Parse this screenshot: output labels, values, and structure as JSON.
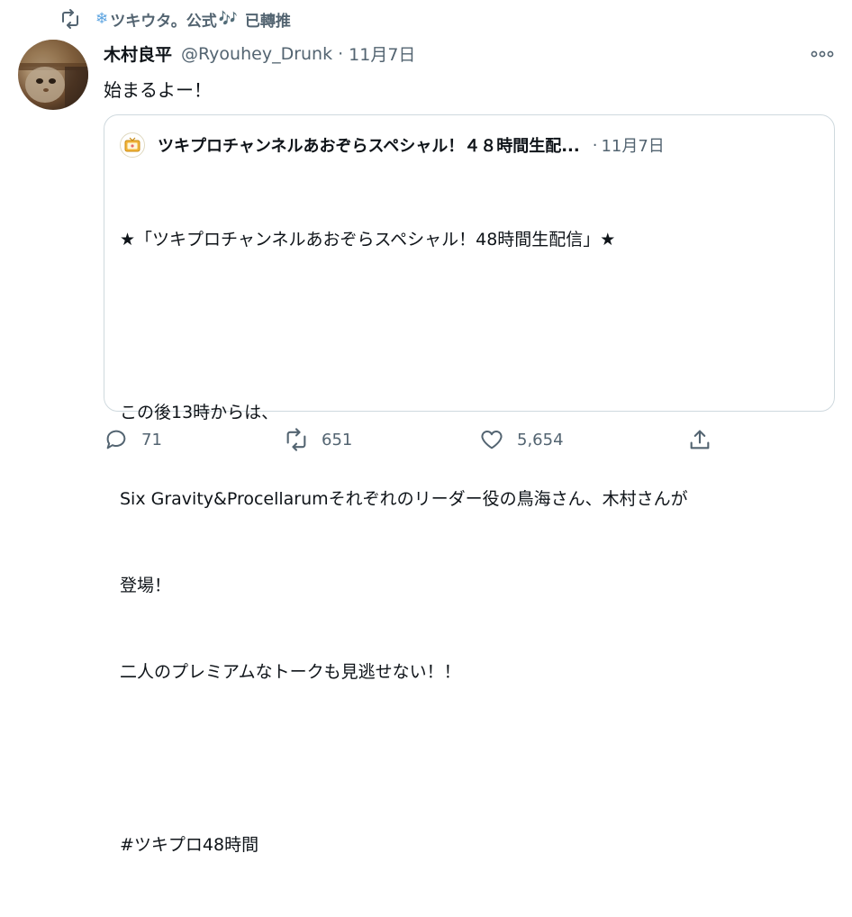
{
  "retweet_bar": {
    "user": "ツキウタ。公式",
    "label": "已轉推",
    "emoji_snow": "❄",
    "emoji_note": "🎶"
  },
  "tweet": {
    "author_name": "木村良平",
    "author_handle": "@Ryouhey_Drunk",
    "separator": "·",
    "date": "11月7日",
    "text": "始まるよー！"
  },
  "quote": {
    "author_name": "ツキプロチャンネルあおぞらスペシャル！４８時間生配...",
    "separator": "·",
    "date": "11月7日",
    "lines": [
      "★「ツキプロチャンネルあおぞらスペシャル！48時間生配信」★",
      "",
      "この後13時からは、",
      "Six Gravity&Procellarumそれぞれのリーダー役の鳥海さん、木村さんが",
      "登場！",
      "二人のプレミアムなトークも見逃せない！！",
      "",
      "#ツキプロ48時間"
    ]
  },
  "actions": {
    "reply_count": "71",
    "retweet_count": "651",
    "like_count": "5,654"
  },
  "colors": {
    "secondary_text": "#536471",
    "border": "#cfd9de",
    "primary_text": "#0f1419"
  }
}
